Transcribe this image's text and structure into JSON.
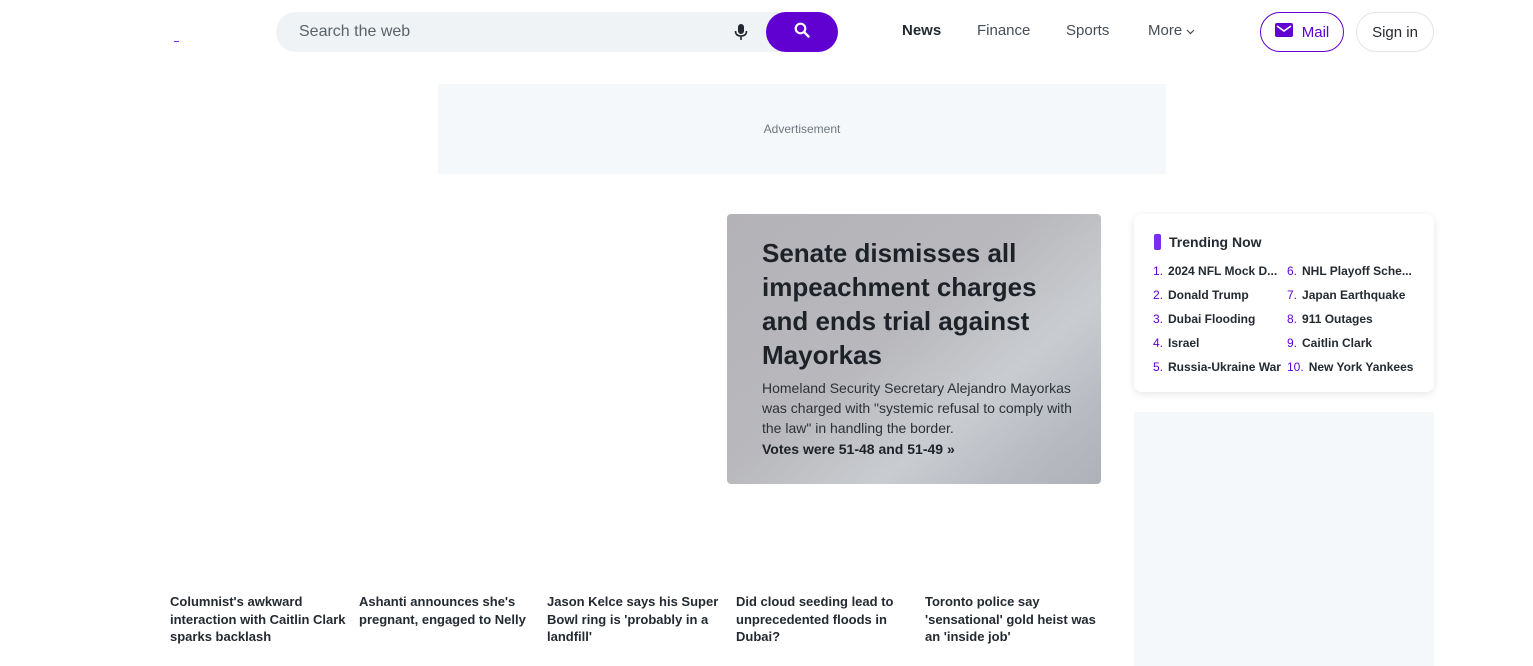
{
  "search": {
    "placeholder": "Search the web"
  },
  "nav": {
    "news": "News",
    "finance": "Finance",
    "sports": "Sports",
    "more": "More"
  },
  "header": {
    "mail_label": "Mail",
    "signin_label": "Sign in"
  },
  "ad": {
    "label": "Advertisement"
  },
  "hero": {
    "title": "Senate dismisses all impeachment charges and ends trial against Mayorkas",
    "description": "Homeland Security Secretary Alejandro Mayorkas was charged with \"systemic refusal to comply with the law\" in handling the border.",
    "link": "Votes were 51-48 and 51-49 »"
  },
  "trending": {
    "title": "Trending Now",
    "items": [
      {
        "num": "1.",
        "label": "2024 NFL Mock D..."
      },
      {
        "num": "2.",
        "label": "Donald Trump"
      },
      {
        "num": "3.",
        "label": "Dubai Flooding"
      },
      {
        "num": "4.",
        "label": "Israel"
      },
      {
        "num": "5.",
        "label": "Russia-Ukraine War"
      },
      {
        "num": "6.",
        "label": "NHL Playoff Sche..."
      },
      {
        "num": "7.",
        "label": "Japan Earthquake"
      },
      {
        "num": "8.",
        "label": "911 Outages"
      },
      {
        "num": "9.",
        "label": "Caitlin Clark"
      },
      {
        "num": "10.",
        "label": "New York Yankees"
      }
    ]
  },
  "stories": [
    {
      "title": "Columnist's awkward interaction with Caitlin Clark sparks backlash"
    },
    {
      "title": "Ashanti announces she's pregnant, engaged to Nelly"
    },
    {
      "title": "Jason Kelce says his Super Bowl ring is 'probably in a landfill'"
    },
    {
      "title": "Did cloud seeding lead to unprecedented floods in Dubai?"
    },
    {
      "title": "Toronto police say 'sensational' gold heist was an 'inside job'"
    }
  ],
  "colors": {
    "brand": "#6001d2",
    "accent": "#7b2cf0"
  }
}
